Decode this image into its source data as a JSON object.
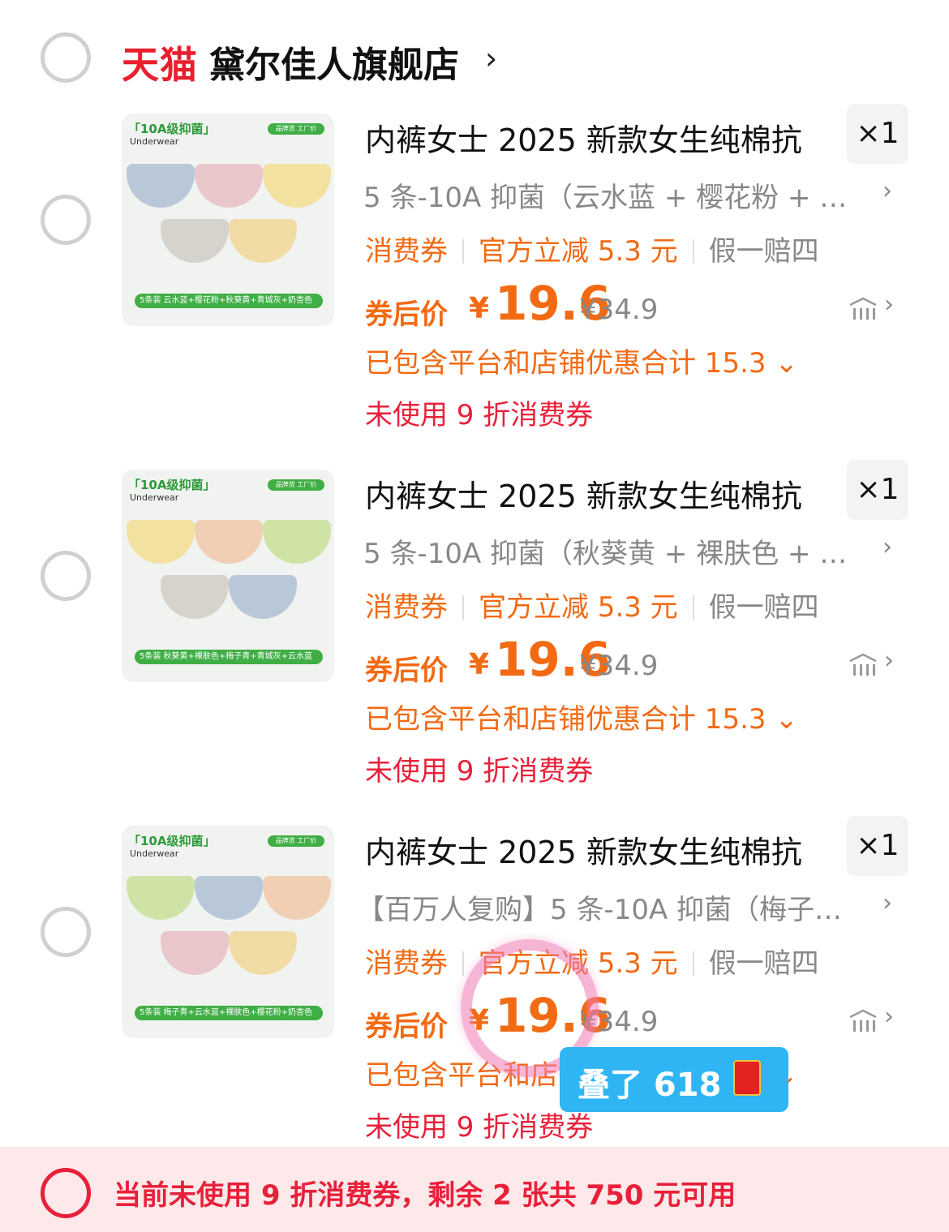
{
  "store": {
    "platform_logo": "天猫",
    "name": "黛尔佳人旗舰店",
    "chevron": "›"
  },
  "items": [
    {
      "title": "内裤女士 2025 新款女生纯棉抗",
      "qty": "×1",
      "sku": "5 条-10A 抑菌（云水蓝 + 樱花粉 + 秋…",
      "promo": [
        "消费券",
        "官方立减 5.3 元",
        "假一赔四"
      ],
      "after_label": "券后价",
      "price_yen": "¥",
      "price": "19.6",
      "original_price": "¥34.9",
      "discount_total": "已包含平台和店铺优惠合计 15.3",
      "coupon_unused": "未使用 9 折消费券",
      "thumb": {
        "tag": "「10A级抑菌」",
        "sub": "Underwear",
        "badge": "品牌货 工厂价",
        "caption": "5条装 云水蓝+樱花粉+秋葵黄+青城灰+奶杏色",
        "colors": [
          "#b9c8d8",
          "#eac7cb",
          "#f3e1a0",
          "#d5d3cc",
          "#f1dca6"
        ]
      }
    },
    {
      "title": "内裤女士 2025 新款女生纯棉抗",
      "qty": "×1",
      "sku": "5 条-10A 抑菌（秋葵黄 + 裸肤色 + 梅…",
      "promo": [
        "消费券",
        "官方立减 5.3 元",
        "假一赔四"
      ],
      "after_label": "券后价",
      "price_yen": "¥",
      "price": "19.6",
      "original_price": "¥34.9",
      "discount_total": "已包含平台和店铺优惠合计 15.3",
      "coupon_unused": "未使用 9 折消费券",
      "thumb": {
        "tag": "「10A级抑菌」",
        "sub": "Underwear",
        "badge": "品牌货 工厂价",
        "caption": "5条装 秋葵黄+裸肤色+梅子青+青城灰+云水蓝",
        "colors": [
          "#f3e1a0",
          "#f1cfb4",
          "#cfe3a6",
          "#d5d3cc",
          "#b9c8d8"
        ]
      }
    },
    {
      "title": "内裤女士 2025 新款女生纯棉抗",
      "qty": "×1",
      "sku": "【百万人复购】5 条-10A 抑菌（梅子…",
      "promo": [
        "消费券",
        "官方立减 5.3 元",
        "假一赔四"
      ],
      "after_label": "券后价",
      "price_yen": "¥",
      "price": "19.6",
      "original_price": "¥34.9",
      "discount_total": "已包含平台和店铺优惠合计 15.3",
      "coupon_unused": "未使用 9 折消费券",
      "thumb": {
        "tag": "「10A级抑菌」",
        "sub": "Underwear",
        "badge": "品牌货 工厂价",
        "caption": "5条装 梅子青+云水蓝+裸肤色+樱花粉+奶杏色",
        "colors": [
          "#cfe3a6",
          "#b9c8d8",
          "#f1cfb4",
          "#eac7cb",
          "#f1dca6"
        ]
      }
    }
  ],
  "toast": {
    "text": "叠了 618",
    "envelope_icon": "red-envelope-icon"
  },
  "bottom_bar": {
    "text": "当前未使用 9 折消费券，剩余 2 张共 750 元可用"
  },
  "colors": {
    "accent_orange": "#f26a13",
    "accent_red": "#e8203a",
    "tmall_red": "#e8202e",
    "toast_blue": "#2fb5f4"
  }
}
